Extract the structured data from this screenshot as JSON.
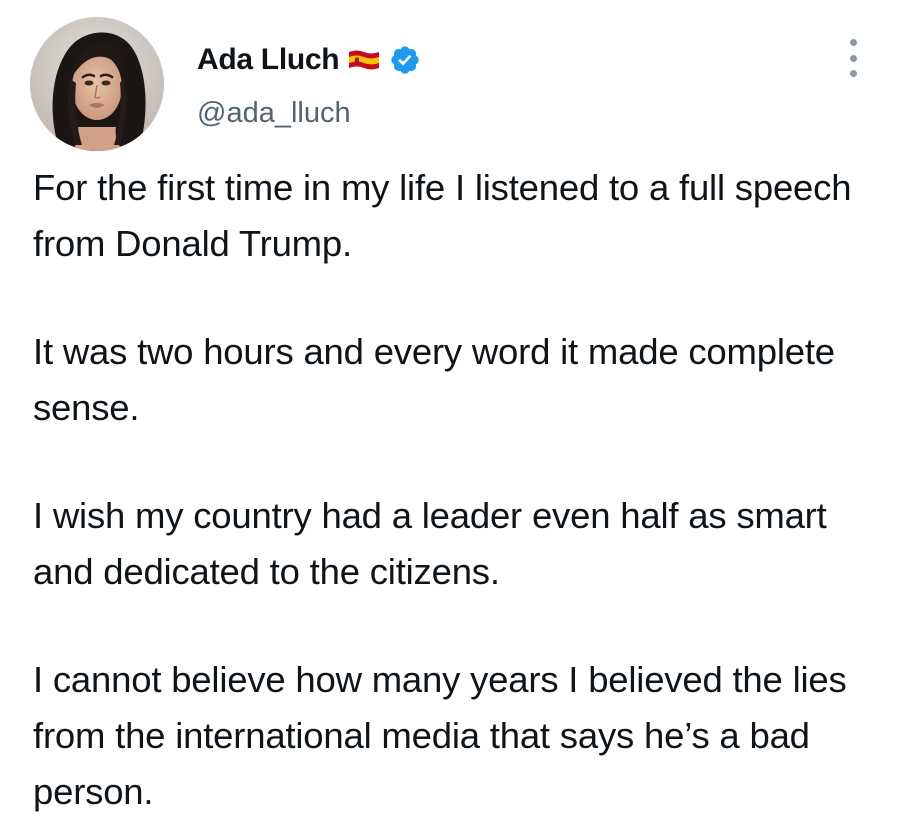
{
  "author": {
    "display_name": "Ada Lluch",
    "handle": "@ada_lluch",
    "flag_icon": "spain-flag-icon",
    "verified_icon": "verified-badge-icon",
    "verified_color": "#1d9bf0"
  },
  "menu": {
    "icon": "more-options-icon"
  },
  "tweet": {
    "paragraphs": [
      "For the first time in my life I listened to a full speech from Donald Trump.",
      "It was two hours and every word it made complete sense.",
      "I wish my country had a leader even half as smart and dedicated to the citizens.",
      "I cannot believe how many years I believed the lies from the international media that says he’s a bad person."
    ]
  },
  "colors": {
    "text": "#0f1419",
    "secondary": "#536471",
    "background": "#ffffff"
  }
}
